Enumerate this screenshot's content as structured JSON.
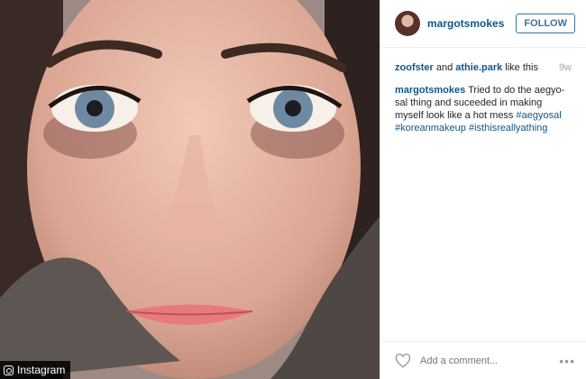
{
  "post": {
    "username": "margotsmokes",
    "follow_label": "FOLLOW",
    "likes": {
      "user1": "zoofster",
      "and_text": "and",
      "user2": "athie.park",
      "suffix": "like this"
    },
    "time_ago": "9w",
    "caption": {
      "username": "margotsmokes",
      "text": "Tried to do the aegyo-sal thing and suceeded in making myself look like a hot mess",
      "hashtags": [
        "#aegyosal",
        "#koreanmakeup",
        "#isthisreallyathing"
      ]
    },
    "comment_placeholder": "Add a comment...",
    "more_label": "•••"
  },
  "watermark": {
    "label": "Instagram"
  },
  "icons": {
    "heart": "heart-icon",
    "camera": "instagram-logo-icon",
    "more": "more-options-icon"
  },
  "colors": {
    "link": "#125688",
    "follow_border": "#3f729b",
    "meta": "#a5a7aa"
  }
}
